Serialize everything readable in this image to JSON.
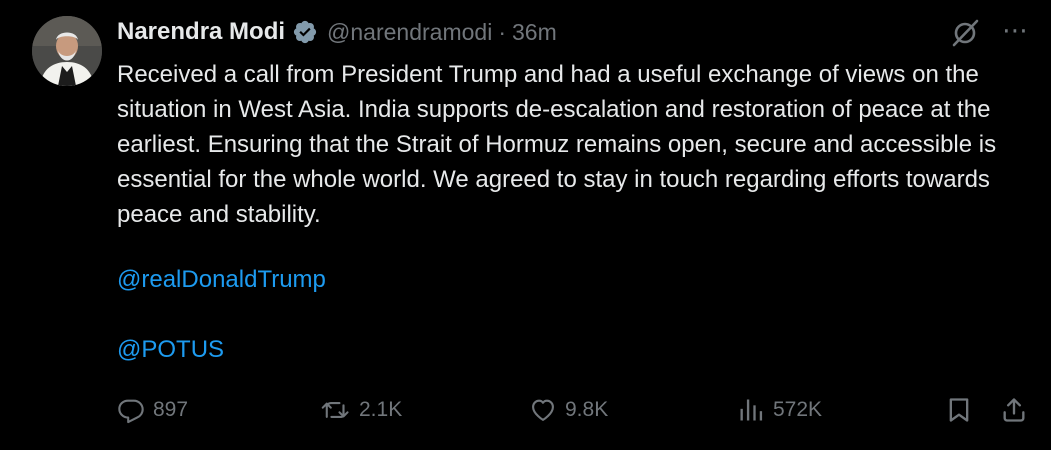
{
  "author": {
    "name": "Narendra Modi",
    "handle": "@narendramodi",
    "separator": "·",
    "time": "36m"
  },
  "tweet": {
    "text": "Received a call from President Trump and had a useful exchange of views on the situation in West Asia. India supports de-escalation and restoration of peace at the earliest. Ensuring that the Strait of Hormuz remains open, secure and accessible is essential for the whole world. We agreed to stay in touch regarding efforts towards peace and stability.",
    "mentions": [
      "@realDonaldTrump",
      "@POTUS"
    ]
  },
  "metrics": {
    "replies": "897",
    "reposts": "2.1K",
    "likes": "9.8K",
    "views": "572K"
  },
  "top_icons": {
    "grok": "grok-icon",
    "more": "⋯"
  },
  "icons": {
    "reply": "reply-icon",
    "repost": "repost-icon",
    "like": "heart-icon",
    "views": "views-icon",
    "bookmark": "bookmark-icon",
    "share": "share-icon"
  },
  "colors": {
    "background": "#000000",
    "text": "#e7e9ea",
    "muted": "#71767b",
    "link": "#1d9bf0",
    "verified": "#829aab"
  }
}
